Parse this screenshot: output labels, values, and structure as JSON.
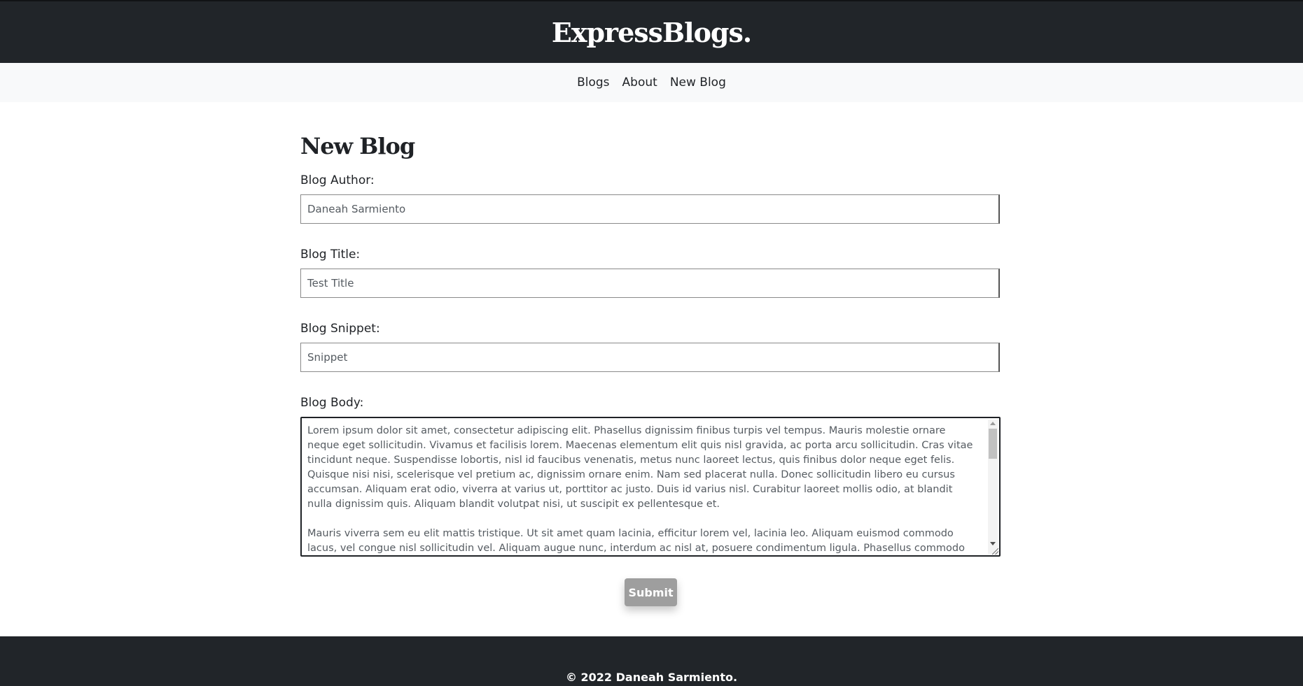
{
  "header": {
    "brand": "ExpressBlogs."
  },
  "nav": {
    "items": [
      {
        "label": "Blogs"
      },
      {
        "label": "About"
      },
      {
        "label": "New Blog"
      }
    ]
  },
  "form": {
    "title": "New Blog",
    "author": {
      "label": "Blog Author:",
      "value": "Daneah Sarmiento"
    },
    "blog_title": {
      "label": "Blog Title:",
      "value": "Test Title"
    },
    "snippet": {
      "label": "Blog Snippet:",
      "value": "Snippet"
    },
    "body": {
      "label": "Blog Body:",
      "value": "Lorem ipsum dolor sit amet, consectetur adipiscing elit. Phasellus dignissim finibus turpis vel tempus. Mauris molestie ornare neque eget sollicitudin. Vivamus et facilisis lorem. Maecenas elementum elit quis nisl gravida, ac porta arcu sollicitudin. Cras vitae tincidunt neque. Suspendisse lobortis, nisl id faucibus venenatis, metus nunc laoreet lectus, quis finibus dolor neque eget felis. Quisque nisi nisi, scelerisque vel pretium ac, dignissim ornare enim. Nam sed placerat nulla. Donec sollicitudin libero eu cursus accumsan. Aliquam erat odio, viverra at varius ut, porttitor ac justo. Duis id varius nisl. Curabitur laoreet mollis odio, at blandit nulla dignissim quis. Aliquam blandit volutpat nisi, ut suscipit ex pellentesque et.\n\nMauris viverra sem eu elit mattis tristique. Ut sit amet quam lacinia, efficitur lorem vel, lacinia leo. Aliquam euismod commodo lacus, vel congue nisl sollicitudin vel. Aliquam augue nunc, interdum ac nisl at, posuere condimentum ligula. Phasellus commodo nisl non tellus"
    },
    "submit_label": "Submit"
  },
  "footer": {
    "text": "© 2022 Daneah Sarmiento."
  },
  "colors": {
    "header_bg": "#212529",
    "nav_bg": "#f8f9fa",
    "submit_bg": "#9e9e9e"
  }
}
